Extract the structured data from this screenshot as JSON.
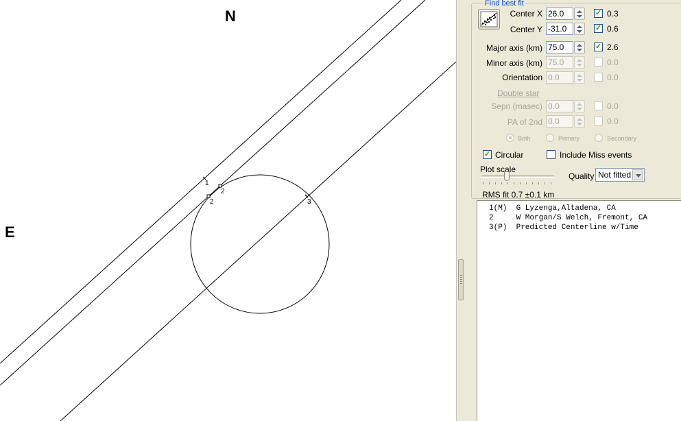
{
  "plot": {
    "compass_north": "N",
    "compass_east": "E",
    "chord_labels": [
      "1",
      "2",
      "2",
      "3"
    ]
  },
  "panel": {
    "group_title": "Find best fit",
    "center_x": {
      "label": "Center X",
      "value": "26.0",
      "checked": true,
      "uncertainty": "0.3"
    },
    "center_y": {
      "label": "Center Y",
      "value": "-31.0",
      "checked": true,
      "uncertainty": "0.6"
    },
    "major_axis": {
      "label": "Major axis (km)",
      "value": "75.0",
      "checked": true,
      "uncertainty": "2.6"
    },
    "minor_axis": {
      "label": "Minor axis (km)",
      "value": "75.0",
      "checked": false,
      "uncertainty": "0.0"
    },
    "orientation": {
      "label": "Orientation",
      "value": "0.0",
      "checked": false,
      "uncertainty": "0.0"
    },
    "double_star_label": "Double star",
    "sepn": {
      "label": "Sepn (masec)",
      "value": "0.0",
      "checked": false,
      "uncertainty": "0.0"
    },
    "pa_of_2nd": {
      "label": "PA of 2nd",
      "value": "0.0",
      "checked": false,
      "uncertainty": "0.0"
    },
    "radio_both": "Both",
    "radio_primary": "Primary",
    "radio_secondary": "Secondary",
    "circular_label": "Circular",
    "circular_checked": true,
    "include_miss_label": "Include Miss events",
    "include_miss_checked": false,
    "plot_scale_label": "Plot scale",
    "quality_label": "Quality",
    "quality_value": "Not fitted",
    "rms_fit": "RMS fit 0.7 ±0.1 km"
  },
  "observers": [
    "1(M)  G Lyzenga,Altadena, CA",
    "2     W Morgan/S Welch, Fremont, CA",
    "3(P)  Predicted Centerline w/Time"
  ],
  "colors": {
    "group_title": "#0046d5",
    "check": "#21a121",
    "panel_bg": "#ece9d8"
  }
}
